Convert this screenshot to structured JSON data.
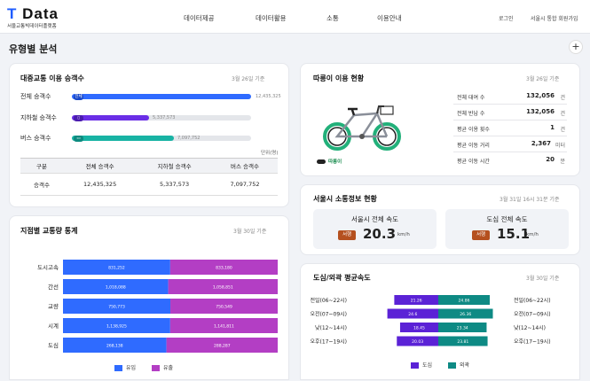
{
  "header": {
    "logo_main": "T Data",
    "logo_sub": "서울교통빅데이터플랫폼",
    "nav": [
      "데이터제공",
      "데이터활용",
      "소통",
      "이용안내"
    ],
    "login": "로그인",
    "signup": "서울시 통합 회원가입"
  },
  "page": {
    "title": "유형별 분석",
    "add": "+"
  },
  "transit": {
    "title": "대중교통 이용 승객수",
    "date": "3월 26일 기준",
    "unit": "단위(명)",
    "bars": [
      {
        "label": "전체 승객수",
        "icon": "전체",
        "value": "12,435,325",
        "ratio": 1.0,
        "color": "#2f6bff"
      },
      {
        "label": "지하철 승객수",
        "icon": "subway-icon",
        "value": "5,337,573",
        "ratio": 0.43,
        "color": "#6a2ee6"
      },
      {
        "label": "버스 승객수",
        "icon": "bus-icon",
        "value": "7,097,752",
        "ratio": 0.57,
        "color": "#18b3a4"
      }
    ],
    "table": {
      "headers": [
        "구분",
        "전체 승객수",
        "지하철 승객수",
        "버스 승객수"
      ],
      "row": [
        "승객수",
        "12,435,325",
        "5,337,573",
        "7,097,752"
      ]
    }
  },
  "bike": {
    "title": "따릉이 이용 현황",
    "date": "3월 26일 기준",
    "brand": "따릉이",
    "stats": [
      {
        "label": "전체 대여 수",
        "value": "132,056",
        "unit": "건"
      },
      {
        "label": "전체 반납 수",
        "value": "132,056",
        "unit": "건"
      },
      {
        "label": "평균 이용 횟수",
        "value": "1",
        "unit": "건"
      },
      {
        "label": "평균 이동 거리",
        "value": "2,367",
        "unit": "미터"
      },
      {
        "label": "평균 이동 시간",
        "value": "20",
        "unit": "분"
      }
    ]
  },
  "speed": {
    "title": "서울시 소통정보 현황",
    "date": "3월 31일 16시 31분 기준",
    "boxes": [
      {
        "title": "서울시 전체 속도",
        "badge": "서행",
        "value": "20.3",
        "unit": "km/h"
      },
      {
        "title": "도심 전체 속도",
        "badge": "서행",
        "value": "15.1",
        "unit": "km/h"
      }
    ]
  },
  "traffic": {
    "title": "지점별 교통량 통계",
    "date": "3월 30일 기준",
    "legend": {
      "inflow": "유입",
      "outflow": "유출"
    },
    "colors": {
      "inflow": "#2f6bff",
      "outflow": "#b33ec4"
    }
  },
  "avgspeed": {
    "title": "도심/외곽 평균속도",
    "date": "3월 30일 기준",
    "legend": {
      "center": "도심",
      "outer": "외곽"
    },
    "colors": {
      "center": "#5b22d6",
      "outer": "#0e8a84"
    }
  },
  "chart_data": [
    {
      "type": "bar",
      "categories": [
        "도시고속",
        "간선",
        "교량",
        "시계",
        "도심"
      ],
      "series": [
        {
          "name": "유입",
          "values": [
            831252,
            1018088,
            750773,
            1138925,
            268138
          ]
        },
        {
          "name": "유출",
          "values": [
            833180,
            1058851,
            750549,
            1141811,
            288287
          ]
        }
      ],
      "value_labels": {
        "유입": [
          "831,252",
          "1,018,088",
          "750,773",
          "1,138,925",
          "268,138"
        ],
        "유출": [
          "833,180",
          "1,058,851",
          "750,549",
          "1,141,811",
          "288,287"
        ]
      }
    },
    {
      "type": "bar",
      "categories": [
        "전일(06~22시)",
        "오전(07~09시)",
        "낮(12~14시)",
        "오후(17~19시)"
      ],
      "series": [
        {
          "name": "도심",
          "values": [
            21.26,
            24.6,
            18.45,
            20.03
          ]
        },
        {
          "name": "외곽",
          "values": [
            24.86,
            26.36,
            23.34,
            23.81
          ]
        }
      ]
    }
  ]
}
